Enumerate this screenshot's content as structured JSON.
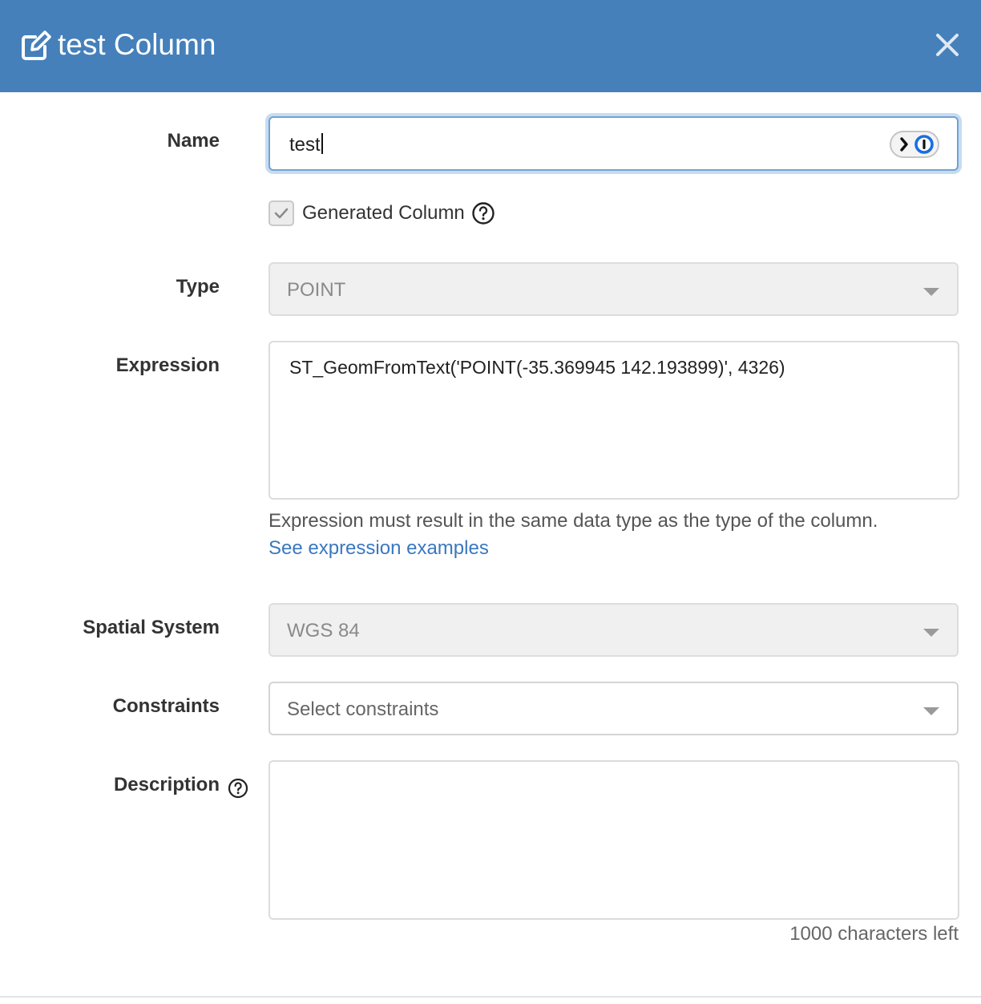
{
  "header": {
    "title": "test Column",
    "edit_icon": "edit-icon",
    "close_icon": "close-icon"
  },
  "form": {
    "name": {
      "label": "Name",
      "value": "test"
    },
    "generated": {
      "label": "Generated Column",
      "checked": true
    },
    "type": {
      "label": "Type",
      "value": "POINT"
    },
    "expression": {
      "label": "Expression",
      "value": "ST_GeomFromText('POINT(-35.369945 142.193899)', 4326)",
      "help": "Expression must result in the same data type as the type of the column.",
      "link": "See expression examples"
    },
    "spatial_system": {
      "label": "Spatial System",
      "value": "WGS 84"
    },
    "constraints": {
      "label": "Constraints",
      "placeholder": "Select constraints"
    },
    "description": {
      "label": "Description",
      "value": "",
      "chars_left": "1000 characters left"
    }
  },
  "colors": {
    "header_bg": "#4580ba",
    "link": "#3a78c0",
    "focus": "#6fa2d8"
  }
}
